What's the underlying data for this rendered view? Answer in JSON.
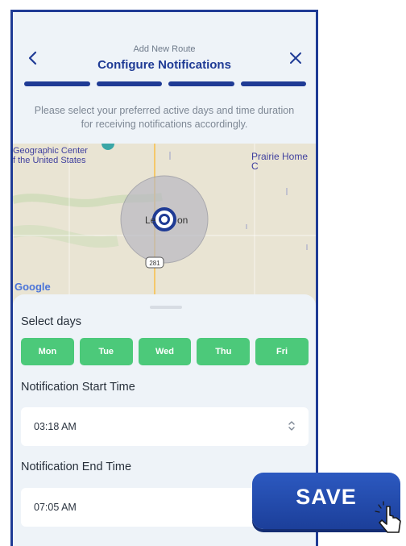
{
  "header": {
    "subtitle": "Add New Route",
    "title": "Configure Notifications",
    "back_icon": "chevron-left-icon",
    "close_icon": "close-icon",
    "steps_total": 4,
    "steps_completed": 4,
    "accent_color": "#1f3b95"
  },
  "intro_text": "Please select your preferred active days and time duration for receiving notifications accordingly.",
  "map": {
    "place_label_line1": "Geographic Center",
    "place_label_line2": "f the United States",
    "place_right": "Prairie Home C",
    "city_left": "Le",
    "city_right": "on",
    "route_shield": "281",
    "provider": "Google"
  },
  "days": {
    "label": "Select days",
    "items": [
      "Mon",
      "Tue",
      "Wed",
      "Thu",
      "Fri"
    ],
    "selected_color": "#4cc97a"
  },
  "start_time": {
    "label": "Notification Start Time",
    "value": "03:18 AM"
  },
  "end_time": {
    "label": "Notification End Time",
    "value": "07:05 AM"
  },
  "save_button": {
    "label": "SAVE",
    "color": "#2c59c0"
  }
}
